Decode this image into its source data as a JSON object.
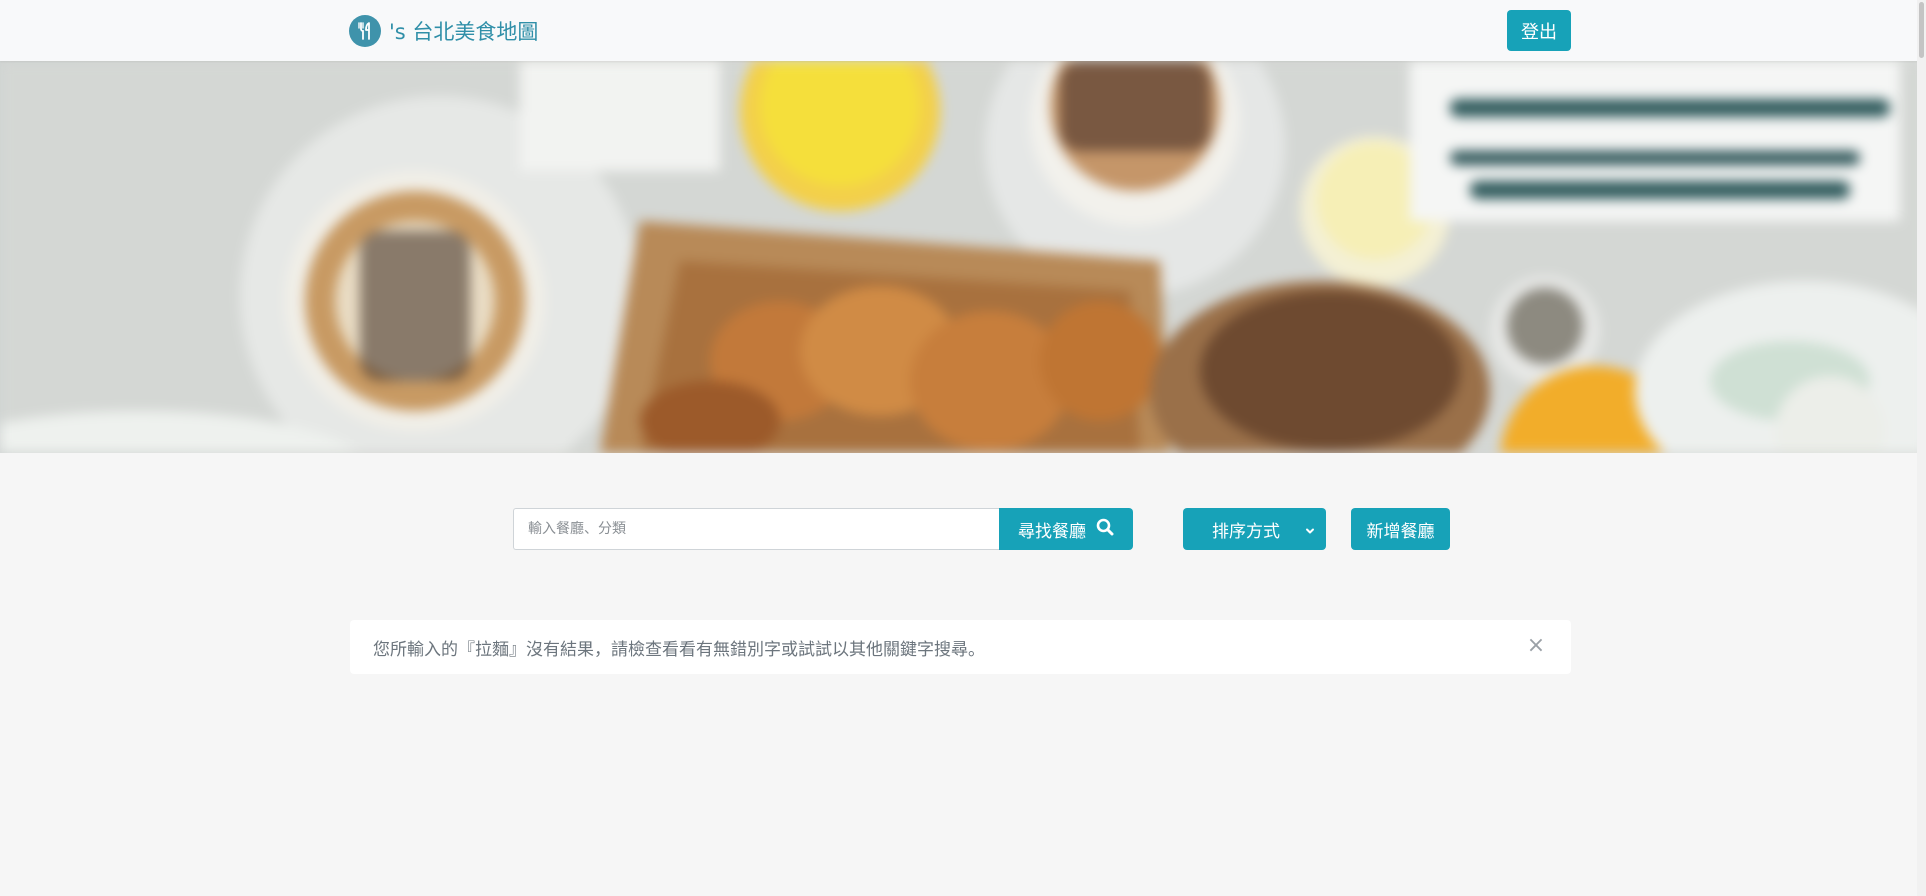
{
  "navbar": {
    "brand_text": "'s 台北美食地圖",
    "brand_icon": "utensils-icon",
    "logout_label": "登出"
  },
  "hero": {
    "image_description": "blurred breakfast table with coffee, croissants and orange juice"
  },
  "search": {
    "placeholder": "輸入餐廳、分類",
    "value": "",
    "button_label": "尋找餐廳",
    "button_icon": "search-icon"
  },
  "sort": {
    "selected": "排序方式",
    "icon": "chevron-down-icon"
  },
  "add_button": {
    "label": "新增餐廳"
  },
  "alert": {
    "message": "您所輸入的『拉麵』沒有結果，請檢查看看有無錯別字或試試以其他關鍵字搜尋。",
    "close_symbol": "×"
  },
  "colors": {
    "accent": "#17a2b8",
    "brand": "#2f8fa8",
    "background": "#f6f6f6",
    "navbar": "#f8f9fa"
  }
}
